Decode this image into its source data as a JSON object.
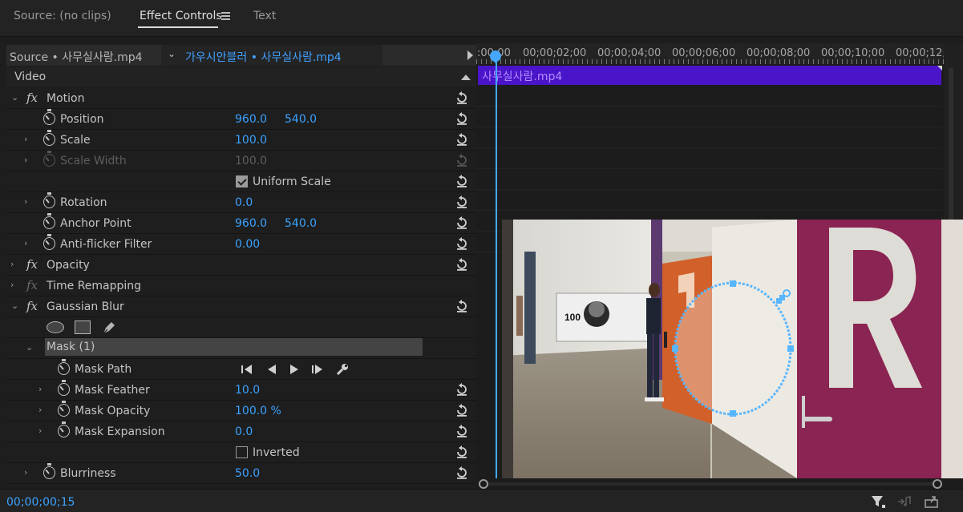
{
  "tabs": [
    {
      "label": "Source: (no clips)"
    },
    {
      "label": "Effect Controls"
    },
    {
      "label": "Text"
    }
  ],
  "source": {
    "left_label": "Source • 사무실사람.mp4",
    "right_label": "가우시안블러 • 사무실사람.mp4"
  },
  "section": {
    "label": "Video"
  },
  "effects": {
    "motion": "Motion",
    "position": {
      "label": "Position",
      "x": "960.0",
      "y": "540.0"
    },
    "scale": {
      "label": "Scale",
      "value": "100.0"
    },
    "scale_width": {
      "label": "Scale Width",
      "value": "100.0"
    },
    "uniform_scale": {
      "label": "Uniform Scale",
      "checked": true
    },
    "rotation": {
      "label": "Rotation",
      "value": "0.0"
    },
    "anchor_point": {
      "label": "Anchor Point",
      "x": "960.0",
      "y": "540.0"
    },
    "anti_flicker": {
      "label": "Anti-flicker Filter",
      "value": "0.00"
    },
    "opacity": "Opacity",
    "time_remapping": "Time Remapping",
    "gaussian_blur": "Gaussian Blur",
    "mask": "Mask (1)",
    "mask_path": {
      "label": "Mask Path"
    },
    "mask_feather": {
      "label": "Mask Feather",
      "value": "10.0"
    },
    "mask_opacity": {
      "label": "Mask Opacity",
      "value": "100.0 %"
    },
    "mask_expansion": {
      "label": "Mask Expansion",
      "value": "0.0"
    },
    "inverted": {
      "label": "Inverted",
      "checked": false
    },
    "blurriness": {
      "label": "Blurriness",
      "value": "50.0"
    }
  },
  "timeline": {
    "ticks": [
      ":00;00",
      "00;00;02;00",
      "00;00;04;00",
      "00;00;06;00",
      "00;00;08;00",
      "00;00;10;00",
      "00;00;12;"
    ],
    "clip_label": "사무실사람.mp4",
    "clip_color": "#4a14c8",
    "playhead_color": "#44a8ff"
  },
  "status": {
    "timecode": "00;00;00;15"
  },
  "colors": {
    "accent": "#3aa2ff",
    "panel": "#1e1e1e"
  }
}
